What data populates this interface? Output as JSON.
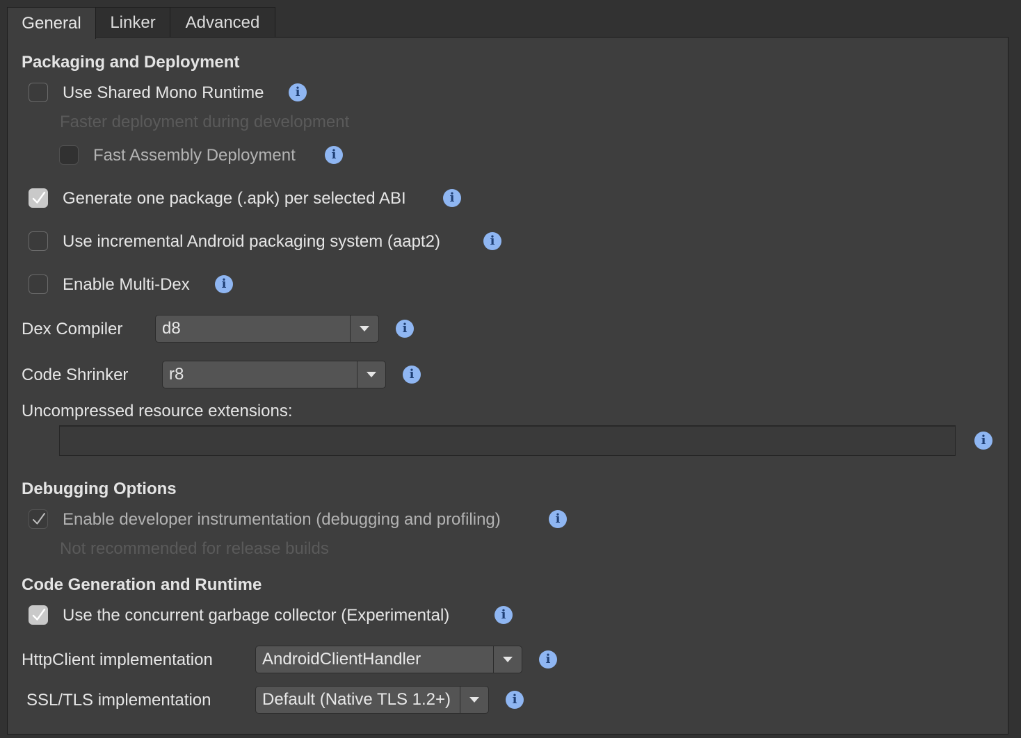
{
  "tabs": [
    {
      "label": "General",
      "active": true
    },
    {
      "label": "Linker",
      "active": false
    },
    {
      "label": "Advanced",
      "active": false
    }
  ],
  "packaging": {
    "title": "Packaging and Deployment",
    "shared_mono": {
      "label": "Use Shared Mono Runtime",
      "checked": false
    },
    "shared_mono_hint": "Faster deployment during development",
    "fast_assembly": {
      "label": "Fast Assembly Deployment",
      "checked": false,
      "enabled": false
    },
    "per_abi": {
      "label": "Generate one package (.apk) per selected ABI",
      "checked": true
    },
    "aapt2": {
      "label": "Use incremental Android packaging system (aapt2)",
      "checked": false
    },
    "multidex": {
      "label": "Enable Multi-Dex",
      "checked": false
    },
    "dex_compiler": {
      "label": "Dex Compiler",
      "value": "d8"
    },
    "code_shrinker": {
      "label": "Code Shrinker",
      "value": "r8"
    },
    "uncompressed": {
      "label": "Uncompressed resource extensions:",
      "value": ""
    }
  },
  "debugging": {
    "title": "Debugging Options",
    "instrumentation": {
      "label": "Enable developer instrumentation (debugging and profiling)",
      "checked": true,
      "enabled": false
    },
    "instrumentation_hint": "Not recommended for release builds"
  },
  "codegen": {
    "title": "Code Generation and Runtime",
    "concurrent_gc": {
      "label": "Use the concurrent garbage collector (Experimental)",
      "checked": true
    },
    "httpclient": {
      "label": "HttpClient implementation",
      "value": "AndroidClientHandler"
    },
    "ssl": {
      "label": "SSL/TLS implementation",
      "value": "Default (Native TLS 1.2+)"
    }
  },
  "info_glyph": "i",
  "colors": {
    "accent_info": "#8fb6f2",
    "background": "#3e3e3e"
  }
}
